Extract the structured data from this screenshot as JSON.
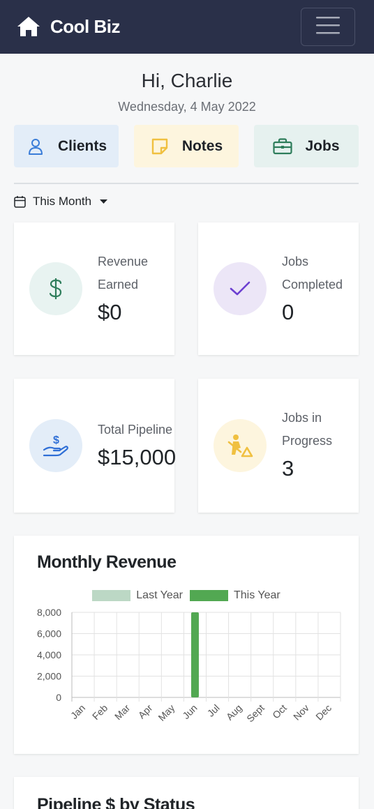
{
  "navbar": {
    "brand_name": "Cool Biz",
    "brand_icon": "home-icon",
    "menu_icon": "hamburger-icon"
  },
  "header": {
    "greeting": "Hi, Charlie",
    "date": "Wednesday, 4 May 2022"
  },
  "quick_links": [
    {
      "label": "Clients",
      "icon": "user-icon",
      "bg": "#e3edf8",
      "color": "#3b7dd8"
    },
    {
      "label": "Notes",
      "icon": "sticky-note-icon",
      "bg": "#fdf5de",
      "color": "#f0c040"
    },
    {
      "label": "Jobs",
      "icon": "briefcase-icon",
      "bg": "#e6f1ef",
      "color": "#2e7d5b"
    }
  ],
  "period": {
    "label": "This Month",
    "icon": "calendar-icon"
  },
  "stats": [
    {
      "label": "Revenue Earned",
      "value": "$0",
      "icon": "dollar-icon",
      "bg": "#e8f3f1",
      "color": "#2e7d5b"
    },
    {
      "label": "Jobs Completed",
      "value": "0",
      "icon": "check-icon",
      "bg": "#ece6f7",
      "color": "#6c3fd1"
    },
    {
      "label": "Total Pipeline",
      "value": "$15,000",
      "icon": "hand-holding-dollar-icon",
      "bg": "#e3edf8",
      "color": "#2f6fd6"
    },
    {
      "label": "Jobs in Progress",
      "value": "3",
      "icon": "person-digging-icon",
      "bg": "#fdf5de",
      "color": "#f0c040"
    }
  ],
  "chart_title": "Monthly Revenue",
  "chart_data": {
    "type": "bar",
    "categories": [
      "Jan",
      "Feb",
      "Mar",
      "Apr",
      "May",
      "Jun",
      "Jul",
      "Aug",
      "Sept",
      "Oct",
      "Nov",
      "Dec"
    ],
    "series": [
      {
        "name": "Last Year",
        "color": "#bcd8c5",
        "values": [
          0,
          0,
          0,
          0,
          0,
          0,
          0,
          0,
          0,
          0,
          0,
          0
        ]
      },
      {
        "name": "This Year",
        "color": "#52a852",
        "values": [
          0,
          0,
          0,
          0,
          0,
          8000,
          0,
          0,
          0,
          0,
          0,
          0
        ]
      }
    ],
    "yticks": [
      "0",
      "2,000",
      "4,000",
      "6,000",
      "8,000"
    ],
    "ylim": [
      0,
      8000
    ],
    "grid": true,
    "legend": "top"
  },
  "next_section_title": "Pipeline $ by Status"
}
